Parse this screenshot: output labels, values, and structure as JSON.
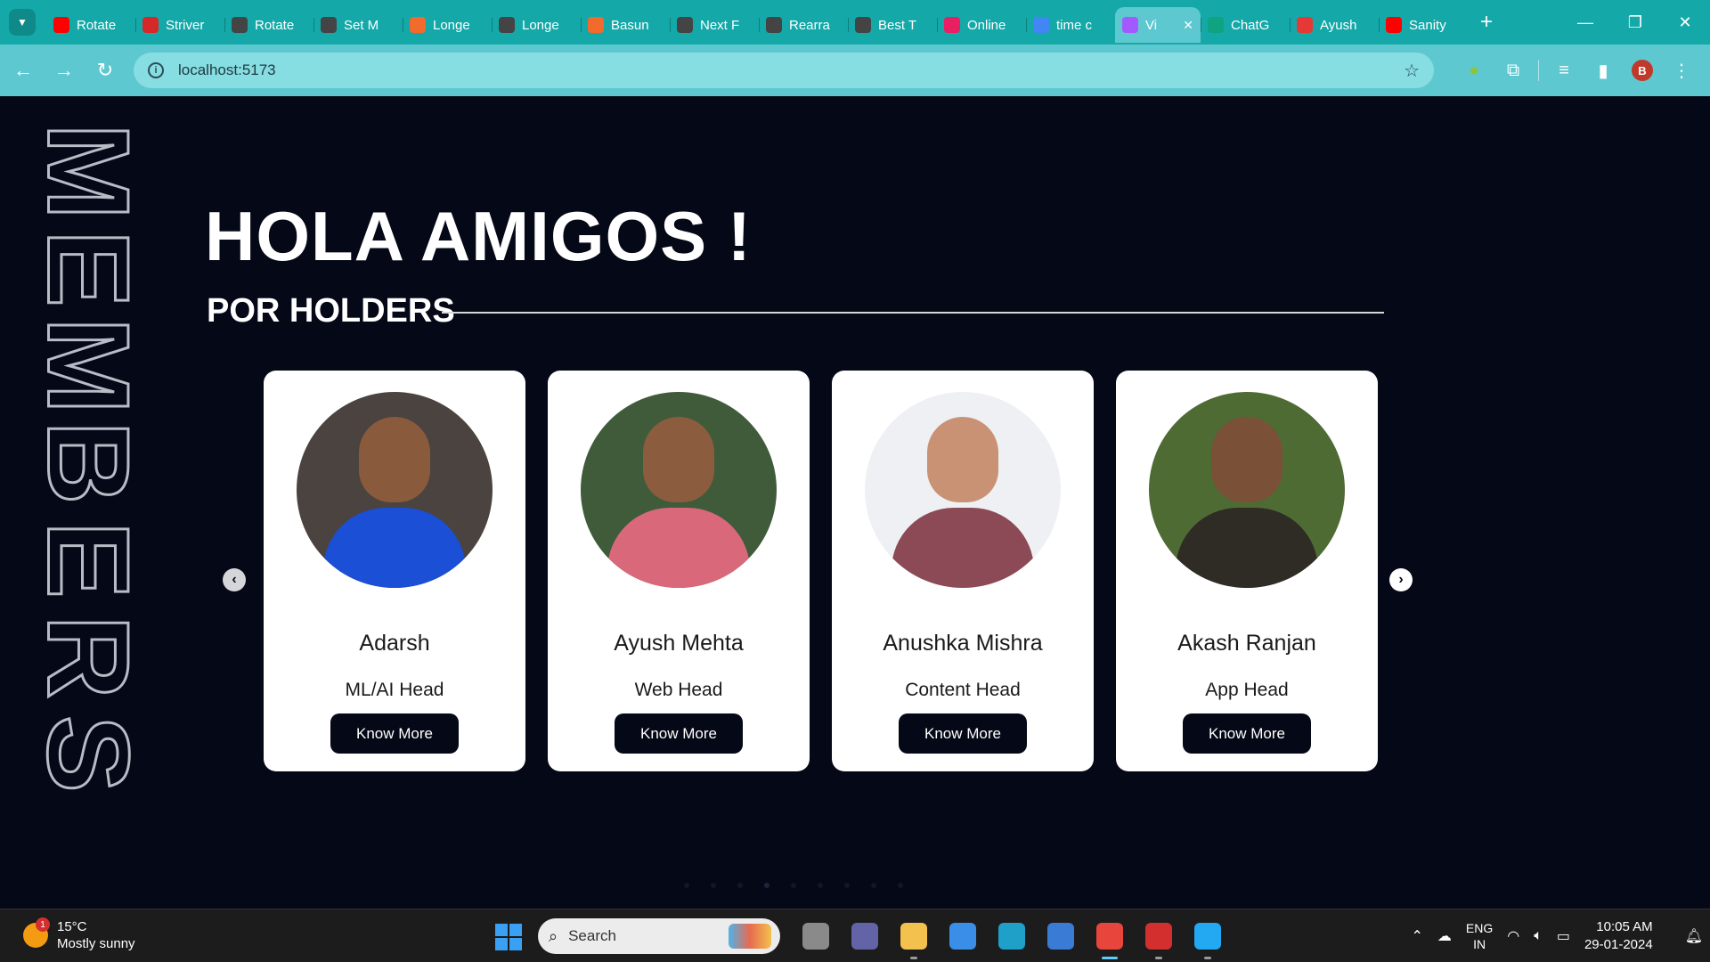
{
  "browser": {
    "tabs": [
      {
        "label": "Rotate",
        "icon": "youtube-icon",
        "color": "#ff0000"
      },
      {
        "label": "Striver",
        "icon": "tuf-icon",
        "color": "#d62828"
      },
      {
        "label": "Rotate",
        "icon": "leetcode-icon",
        "color": "#444444"
      },
      {
        "label": "Set M",
        "icon": "leetcode-icon",
        "color": "#444444"
      },
      {
        "label": "Longe",
        "icon": "codingninjas-icon",
        "color": "#f26b2c"
      },
      {
        "label": "Longe",
        "icon": "leetcode-icon",
        "color": "#444444"
      },
      {
        "label": "Basun",
        "icon": "codingninjas-icon",
        "color": "#f26b2c"
      },
      {
        "label": "Next F",
        "icon": "leetcode-icon",
        "color": "#444444"
      },
      {
        "label": "Rearra",
        "icon": "leetcode-icon",
        "color": "#444444"
      },
      {
        "label": "Best T",
        "icon": "leetcode-icon",
        "color": "#444444"
      },
      {
        "label": "Online",
        "icon": "online-icon",
        "color": "#e91e63"
      },
      {
        "label": "time c",
        "icon": "google-icon",
        "color": "#4285f4"
      },
      {
        "label": "Vi",
        "icon": "vite-icon",
        "color": "#a259ff",
        "active": true
      },
      {
        "label": "ChatG",
        "icon": "chatgpt-icon",
        "color": "#10a37f"
      },
      {
        "label": "Ayush",
        "icon": "s-icon",
        "color": "#e53935"
      },
      {
        "label": "Sanity",
        "icon": "youtube-icon",
        "color": "#ff0000"
      }
    ],
    "url": "localhost:5173",
    "profile_initial": "B"
  },
  "page": {
    "vertical_title": [
      "M",
      "E",
      "M",
      "B",
      "E",
      "R",
      "S"
    ],
    "hero_title": "HOLA AMIGOS !",
    "section_heading": "POR HOLDERS",
    "members": [
      {
        "name": "Adarsh",
        "role": "ML/AI Head",
        "button": "Know More",
        "shirt": "#1a4fd6",
        "bg": "#4a4340",
        "skin": "#8a5a3c"
      },
      {
        "name": "Ayush Mehta",
        "role": "Web Head",
        "button": "Know More",
        "shirt": "#d9687a",
        "bg": "#3f5b3a",
        "skin": "#8c5c3e"
      },
      {
        "name": "Anushka Mishra",
        "role": "Content Head",
        "button": "Know More",
        "shirt": "#8b4a55",
        "bg": "#eef0f3",
        "skin": "#c99274"
      },
      {
        "name": "Akash Ranjan",
        "role": "App Head",
        "button": "Know More",
        "shirt": "#2f2b25",
        "bg": "#4f6b34",
        "skin": "#7a5036"
      }
    ],
    "carousel_dots": 9,
    "active_dot": 3
  },
  "taskbar": {
    "weather_badge": "1",
    "temperature": "15°C",
    "condition": "Mostly sunny",
    "search_placeholder": "Search",
    "lang_top": "ENG",
    "lang_bottom": "IN",
    "time": "10:05 AM",
    "date": "29-01-2024",
    "apps": [
      {
        "name": "task-view-icon",
        "color": "#8a8a8a",
        "running": false
      },
      {
        "name": "teams-icon",
        "color": "#6264a7",
        "running": false
      },
      {
        "name": "file-explorer-icon",
        "color": "#f2c14e",
        "running": true
      },
      {
        "name": "microsoft-store-icon",
        "color": "#3b8ee8",
        "running": false
      },
      {
        "name": "edge-icon",
        "color": "#1ea0c9",
        "running": false
      },
      {
        "name": "python-idle-icon",
        "color": "#3a7bd5",
        "running": false
      },
      {
        "name": "chrome-icon",
        "color": "#e8453c",
        "running": true,
        "focused": true
      },
      {
        "name": "acrobat-icon",
        "color": "#d32f2f",
        "running": true
      },
      {
        "name": "vscode-icon",
        "color": "#23a8f2",
        "running": true
      }
    ]
  }
}
